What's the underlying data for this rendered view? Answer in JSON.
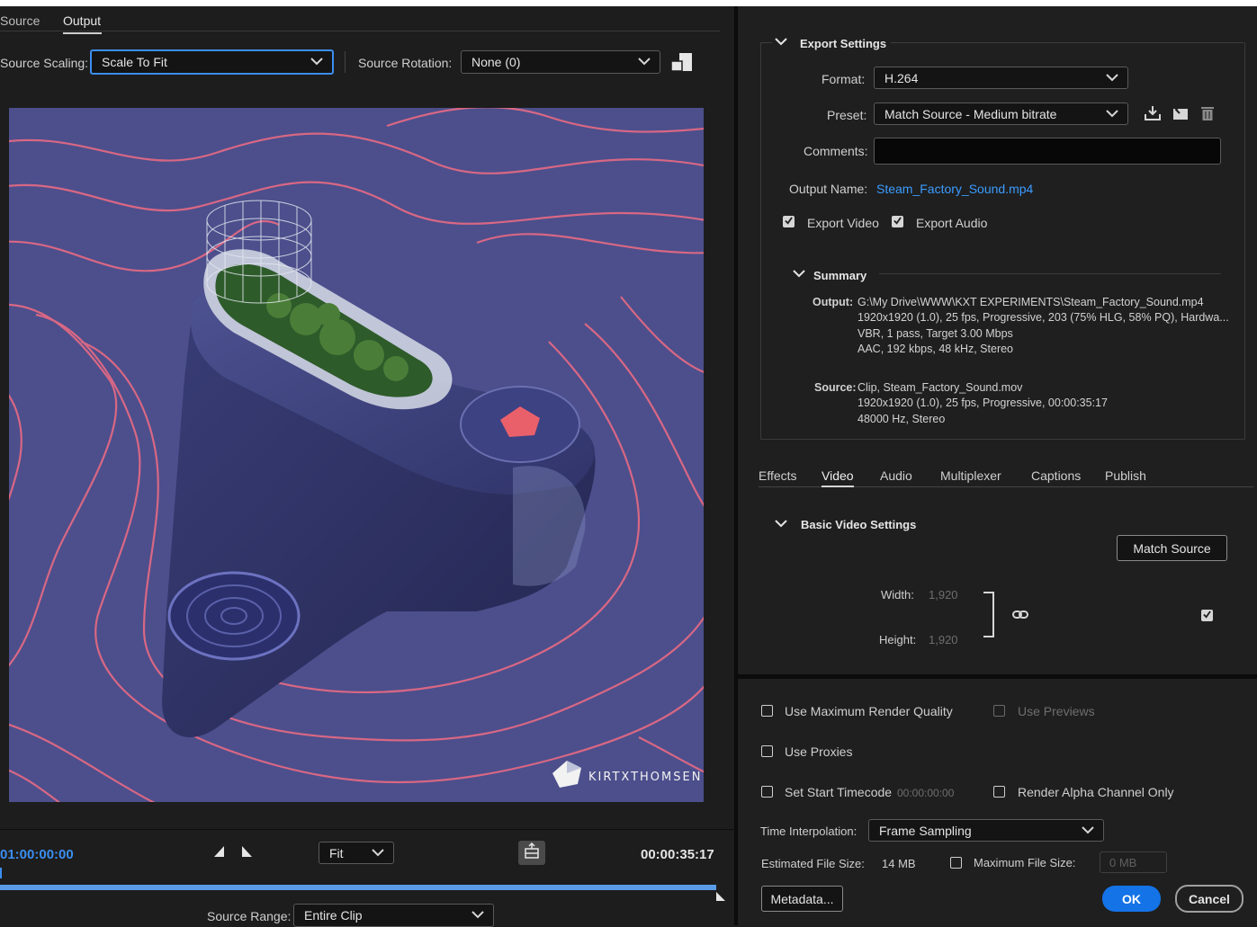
{
  "tabs": [
    {
      "label": "Source"
    },
    {
      "label": "Output"
    }
  ],
  "output_controls": {
    "source_scaling_label": "Source Scaling:",
    "source_scaling_value": "Scale To Fit",
    "source_rotation_label": "Source Rotation:",
    "source_rotation_value": "None (0)"
  },
  "preview": {
    "watermark": "KIRTXTHOMSEN"
  },
  "timeline": {
    "current_time": "01:00:00:00",
    "zoom_value": "Fit",
    "duration": "00:00:35:17",
    "progress_fraction": 1.0,
    "source_range_label": "Source Range:",
    "source_range_value": "Entire Clip"
  },
  "export_settings": {
    "title": "Export Settings",
    "format_label": "Format:",
    "format_value": "H.264",
    "preset_label": "Preset:",
    "preset_value": "Match Source - Medium bitrate",
    "comments_label": "Comments:",
    "comments_value": "",
    "output_name_label": "Output Name:",
    "output_name_value": "Steam_Factory_Sound.mp4",
    "export_video_label": "Export Video",
    "export_video_checked": true,
    "export_audio_label": "Export Audio",
    "export_audio_checked": true
  },
  "summary": {
    "title": "Summary",
    "output_label": "Output:",
    "output_lines": [
      "G:\\My Drive\\WWW\\KXT EXPERIMENTS\\Steam_Factory_Sound.mp4",
      "1920x1920 (1.0), 25 fps, Progressive, 203 (75% HLG, 58% PQ), Hardwa...",
      "VBR, 1 pass, Target 3.00 Mbps",
      "AAC, 192 kbps, 48 kHz, Stereo"
    ],
    "source_label": "Source:",
    "source_lines": [
      "Clip, Steam_Factory_Sound.mov",
      "1920x1920 (1.0), 25 fps, Progressive, 00:00:35:17",
      "48000 Hz, Stereo"
    ]
  },
  "settings_tabs": [
    {
      "label": "Effects"
    },
    {
      "label": "Video"
    },
    {
      "label": "Audio"
    },
    {
      "label": "Multiplexer"
    },
    {
      "label": "Captions"
    },
    {
      "label": "Publish"
    }
  ],
  "basic_video": {
    "title": "Basic Video Settings",
    "match_source_label": "Match Source",
    "width_label": "Width:",
    "width_value": "1,920",
    "height_label": "Height:",
    "height_value": "1,920"
  },
  "render_options": {
    "max_render_quality": "Use Maximum Render Quality",
    "use_previews": "Use Previews",
    "use_proxies": "Use Proxies",
    "set_start_timecode": "Set Start Timecode",
    "start_timecode_value": "00:00:00:00",
    "render_alpha_only": "Render Alpha Channel Only",
    "time_interpolation_label": "Time Interpolation:",
    "time_interpolation_value": "Frame Sampling",
    "estimated_size_label": "Estimated File Size:",
    "estimated_size_value": "14 MB",
    "max_file_size_label": "Maximum File Size:",
    "max_file_size_value": "0 MB"
  },
  "footer": {
    "metadata_label": "Metadata...",
    "ok_label": "OK",
    "cancel_label": "Cancel"
  }
}
